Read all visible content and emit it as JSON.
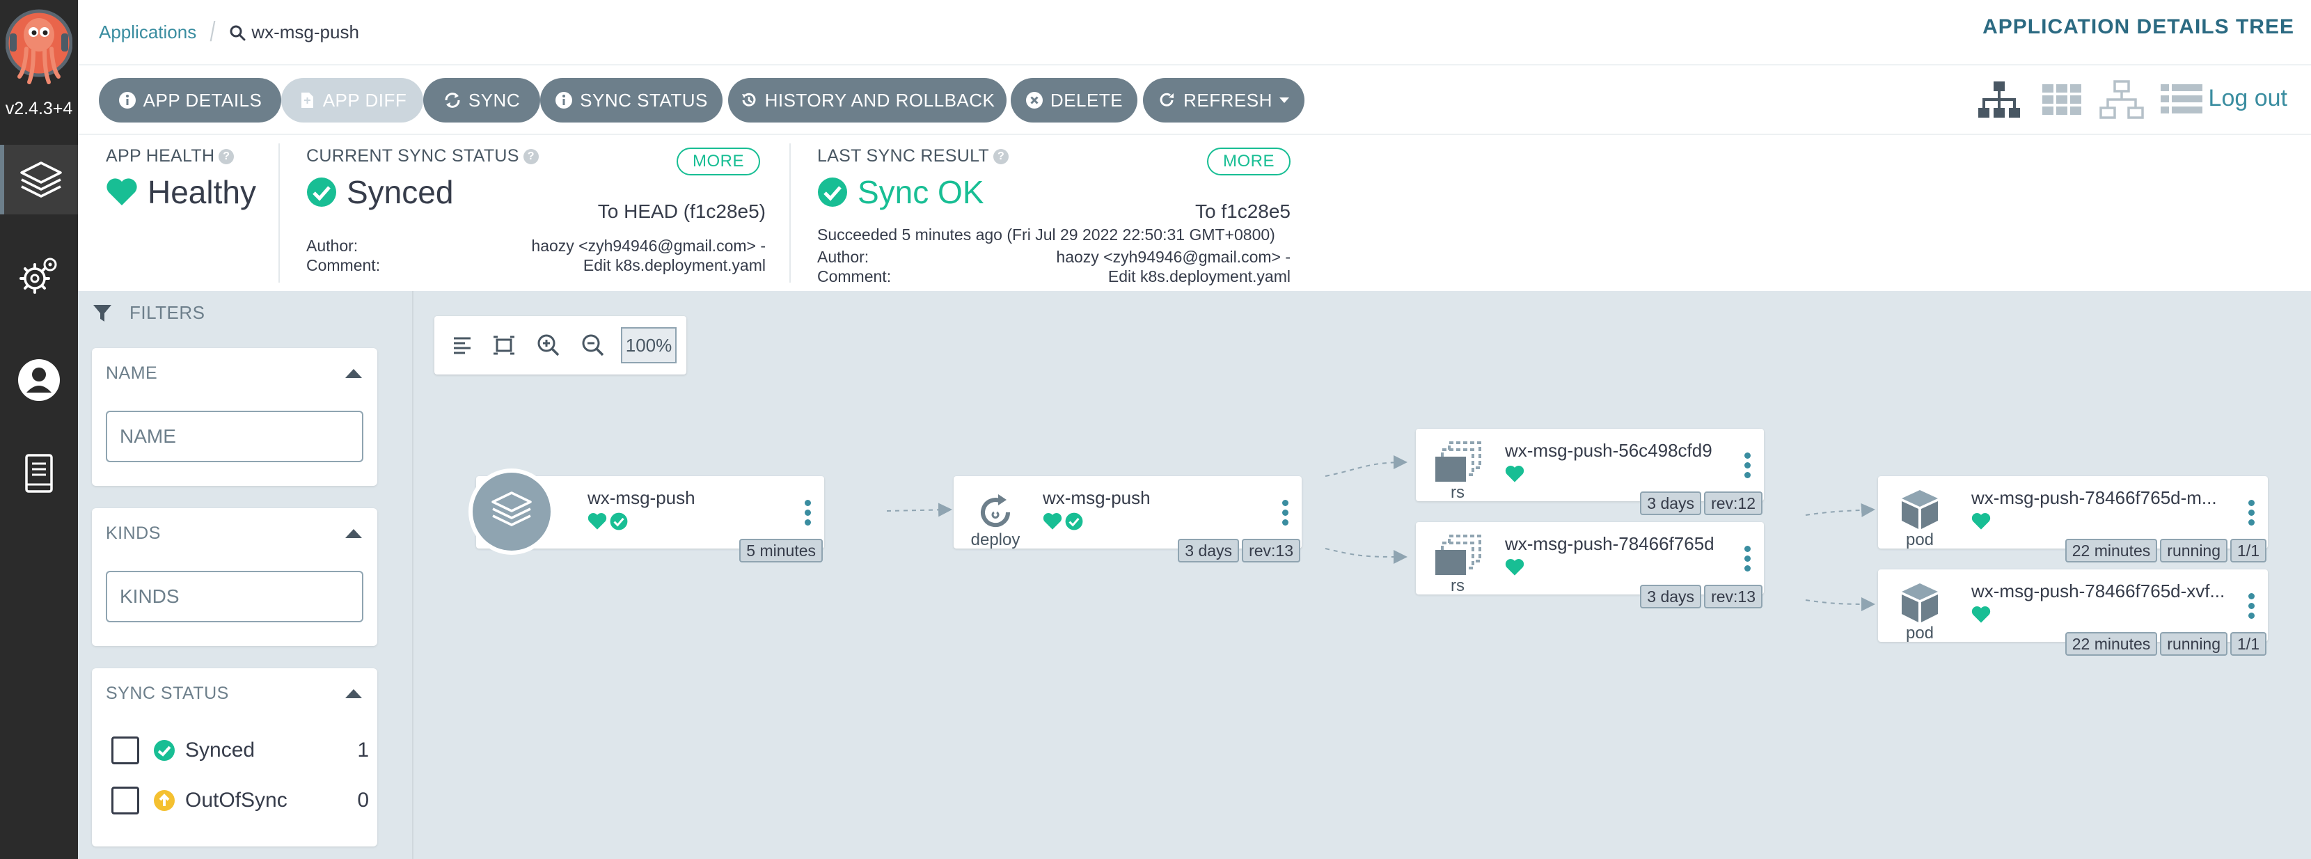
{
  "sidebar": {
    "version": "v2.4.3+4",
    "items": [
      {
        "name": "applications",
        "icon": "layers-icon"
      },
      {
        "name": "settings",
        "icon": "gears-icon"
      },
      {
        "name": "user-info",
        "icon": "user-icon"
      },
      {
        "name": "docs",
        "icon": "book-icon"
      }
    ]
  },
  "topbar": {
    "breadcrumb_root": "Applications",
    "breadcrumb_current": "wx-msg-push",
    "title": "APPLICATION DETAILS TREE"
  },
  "toolbar": {
    "app_details": "APP DETAILS",
    "app_diff": "APP DIFF",
    "sync": "SYNC",
    "sync_status": "SYNC STATUS",
    "history": "HISTORY AND ROLLBACK",
    "delete": "DELETE",
    "refresh": "REFRESH",
    "logout": "Log out"
  },
  "status": {
    "health_label": "APP HEALTH",
    "health_value": "Healthy",
    "sync_label": "CURRENT SYNC STATUS",
    "sync_value": "Synced",
    "sync_target": "To HEAD (f1c28e5)",
    "more": "MORE",
    "author_label": "Author:",
    "comment_label": "Comment:",
    "author": "haozy <zyh94946@gmail.com> -",
    "comment": "Edit k8s.deployment.yaml",
    "last_label": "LAST SYNC RESULT",
    "last_value": "Sync OK",
    "last_target": "To f1c28e5",
    "last_succeeded": "Succeeded 5 minutes ago (Fri Jul 29 2022 22:50:31 GMT+0800)",
    "last_author": "haozy <zyh94946@gmail.com> -",
    "last_comment": "Edit k8s.deployment.yaml"
  },
  "filters": {
    "title": "FILTERS",
    "name_title": "NAME",
    "name_placeholder": "NAME",
    "kinds_title": "KINDS",
    "kinds_placeholder": "KINDS",
    "sync_title": "SYNC STATUS",
    "synced_label": "Synced",
    "synced_count": "1",
    "outofsync_label": "OutOfSync",
    "outofsync_count": "0"
  },
  "graph": {
    "zoom": "100%",
    "app": {
      "name": "wx-msg-push",
      "tag": "5 minutes"
    },
    "deploy": {
      "name": "wx-msg-push",
      "kind": "deploy",
      "tags": [
        "3 days",
        "rev:13"
      ]
    },
    "rs1": {
      "name": "wx-msg-push-56c498cfd9",
      "kind": "rs",
      "tags": [
        "3 days",
        "rev:12"
      ]
    },
    "rs2": {
      "name": "wx-msg-push-78466f765d",
      "kind": "rs",
      "tags": [
        "3 days",
        "rev:13"
      ]
    },
    "pod1": {
      "name": "wx-msg-push-78466f765d-m...",
      "kind": "pod",
      "tags": [
        "22 minutes",
        "running",
        "1/1"
      ]
    },
    "pod2": {
      "name": "wx-msg-push-78466f765d-xvf...",
      "kind": "pod",
      "tags": [
        "22 minutes",
        "running",
        "1/1"
      ]
    }
  },
  "colors": {
    "accent": "#3a8da0",
    "healthy": "#18be94",
    "button": "#6d7f8b",
    "outofsync": "#f4c030"
  }
}
